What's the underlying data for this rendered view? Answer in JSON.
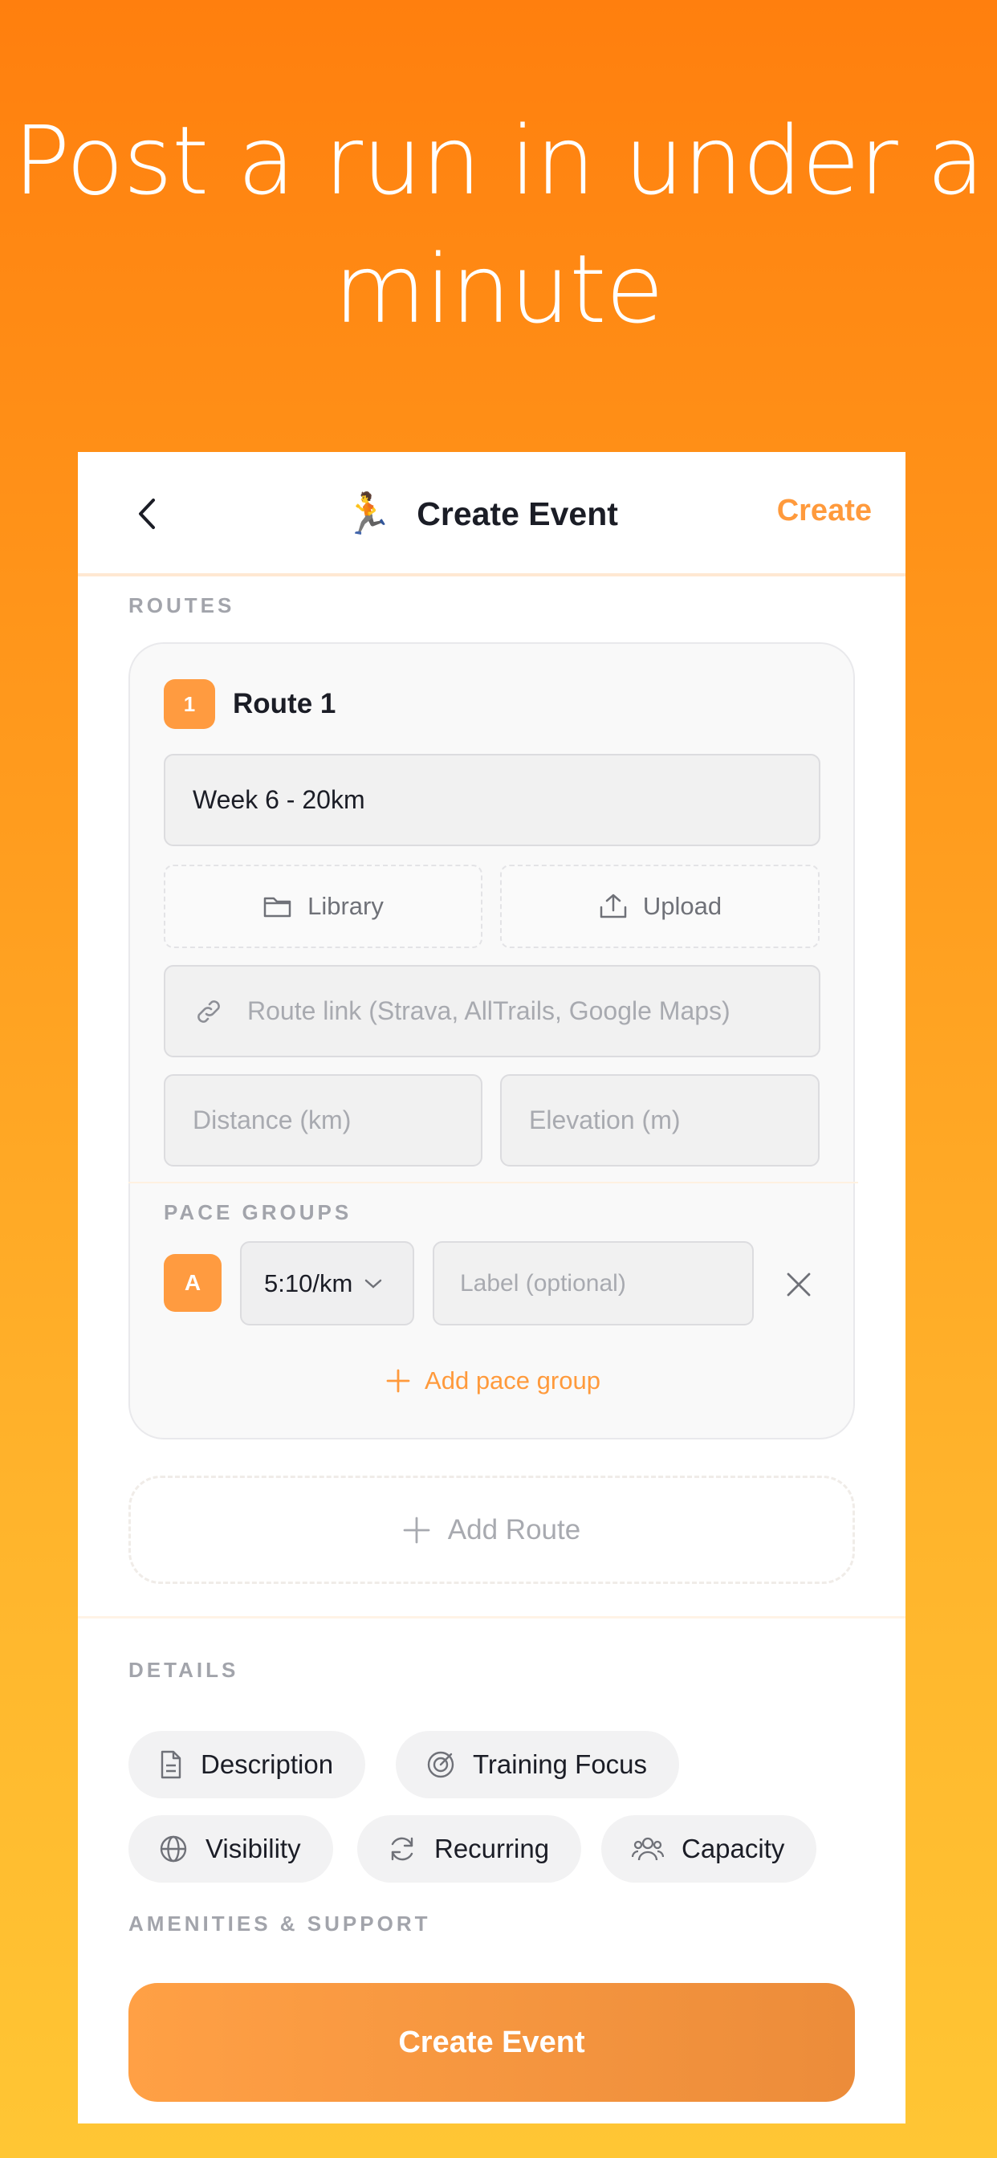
{
  "headline": "Post a run in under a minute",
  "nav": {
    "title": "Create Event",
    "create_label": "Create",
    "runner_emoji": "🏃"
  },
  "routes": {
    "section_label": "ROUTES",
    "route_number": "1",
    "route_title": "Route 1",
    "name_value": "Week 6 - 20km",
    "library_label": "Library",
    "upload_label": "Upload",
    "link_placeholder": "Route link (Strava, AllTrails, Google Maps)",
    "distance_placeholder": "Distance (km)",
    "elevation_placeholder": "Elevation (m)",
    "pace_section_label": "PACE GROUPS",
    "pace_badge": "A",
    "pace_value": "5:10/km",
    "pace_label_placeholder": "Label (optional)",
    "add_pace_label": "Add pace group",
    "add_route_label": "Add Route"
  },
  "details": {
    "section_label": "DETAILS",
    "chips": [
      "Description",
      "Training Focus",
      "Visibility",
      "Recurring",
      "Capacity"
    ]
  },
  "amenities": {
    "section_label": "AMENITIES & SUPPORT"
  },
  "cta_label": "Create Event",
  "colors": {
    "accent": "#ff9a3c",
    "badge": "#ff9b40",
    "bg_top": "#ff7f0e",
    "bg_bottom": "#ffc634"
  },
  "icons": [
    "back-chevron-icon",
    "runner-icon",
    "folder-icon",
    "upload-icon",
    "link-icon",
    "chevron-down-icon",
    "close-icon",
    "plus-icon",
    "document-icon",
    "target-icon",
    "globe-icon",
    "refresh-icon",
    "people-icon"
  ]
}
